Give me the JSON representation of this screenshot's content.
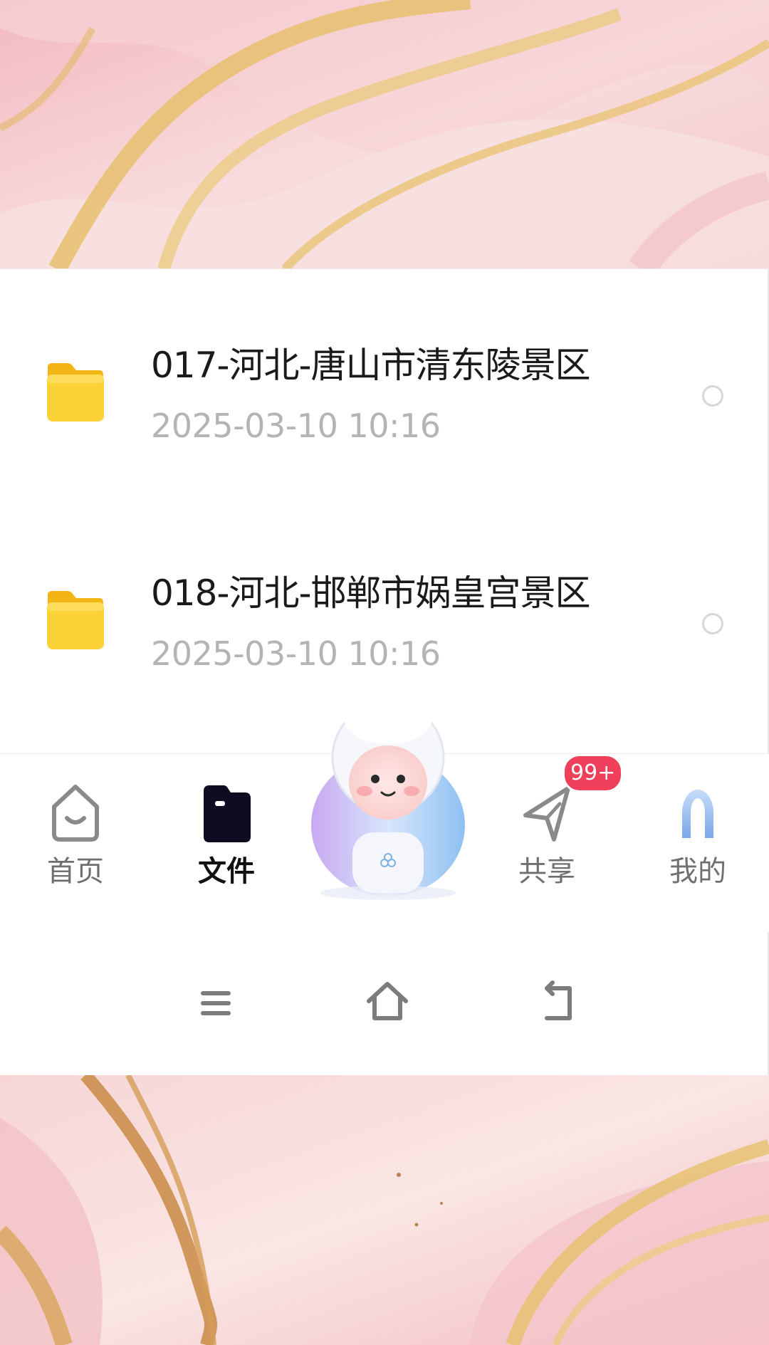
{
  "files": [
    {
      "name": "017-河北-唐山市清东陵景区",
      "date": "2025-03-10  10:16",
      "icon": "folder-icon"
    },
    {
      "name": "018-河北-邯郸市娲皇宫景区",
      "date": "2025-03-10  10:16",
      "icon": "folder-icon"
    }
  ],
  "tabbar": {
    "home_label": "首页",
    "files_label": "文件",
    "share_label": "共享",
    "mine_label": "我的",
    "share_badge": "99+",
    "active_tab": "文件"
  },
  "colors": {
    "folder": "#f9c51f",
    "badge": "#ef3f5b",
    "active_tab": "#111111",
    "inactive_tab": "#6f6f6f",
    "date_text": "#b4b4b4",
    "marble_pink": "#f4c9cc",
    "marble_gold": "#e6c06d"
  },
  "system_nav": {
    "buttons": [
      "menu-icon",
      "home-icon",
      "back-icon"
    ]
  }
}
